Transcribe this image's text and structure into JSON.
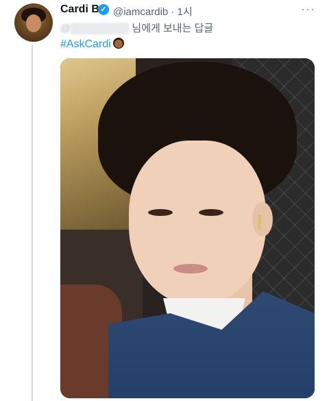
{
  "tweet": {
    "name": "Cardi B",
    "handle": "@iamcardib",
    "separator": "·",
    "time": "1시",
    "reply_to_blurred": "@▒▒▒▒▒▒▒▒",
    "reply_suffix": " 님에게 보내는 답글",
    "hashtag": "#AskCardi",
    "more_icon": "···"
  },
  "icons": {
    "verified": "verified-badge-icon",
    "more": "more-options-icon",
    "hashtag_emoji": "emoji-icon"
  },
  "colors": {
    "link": "#1d9bf0",
    "secondary_text": "#536471",
    "thread_line": "#cfd9de"
  }
}
